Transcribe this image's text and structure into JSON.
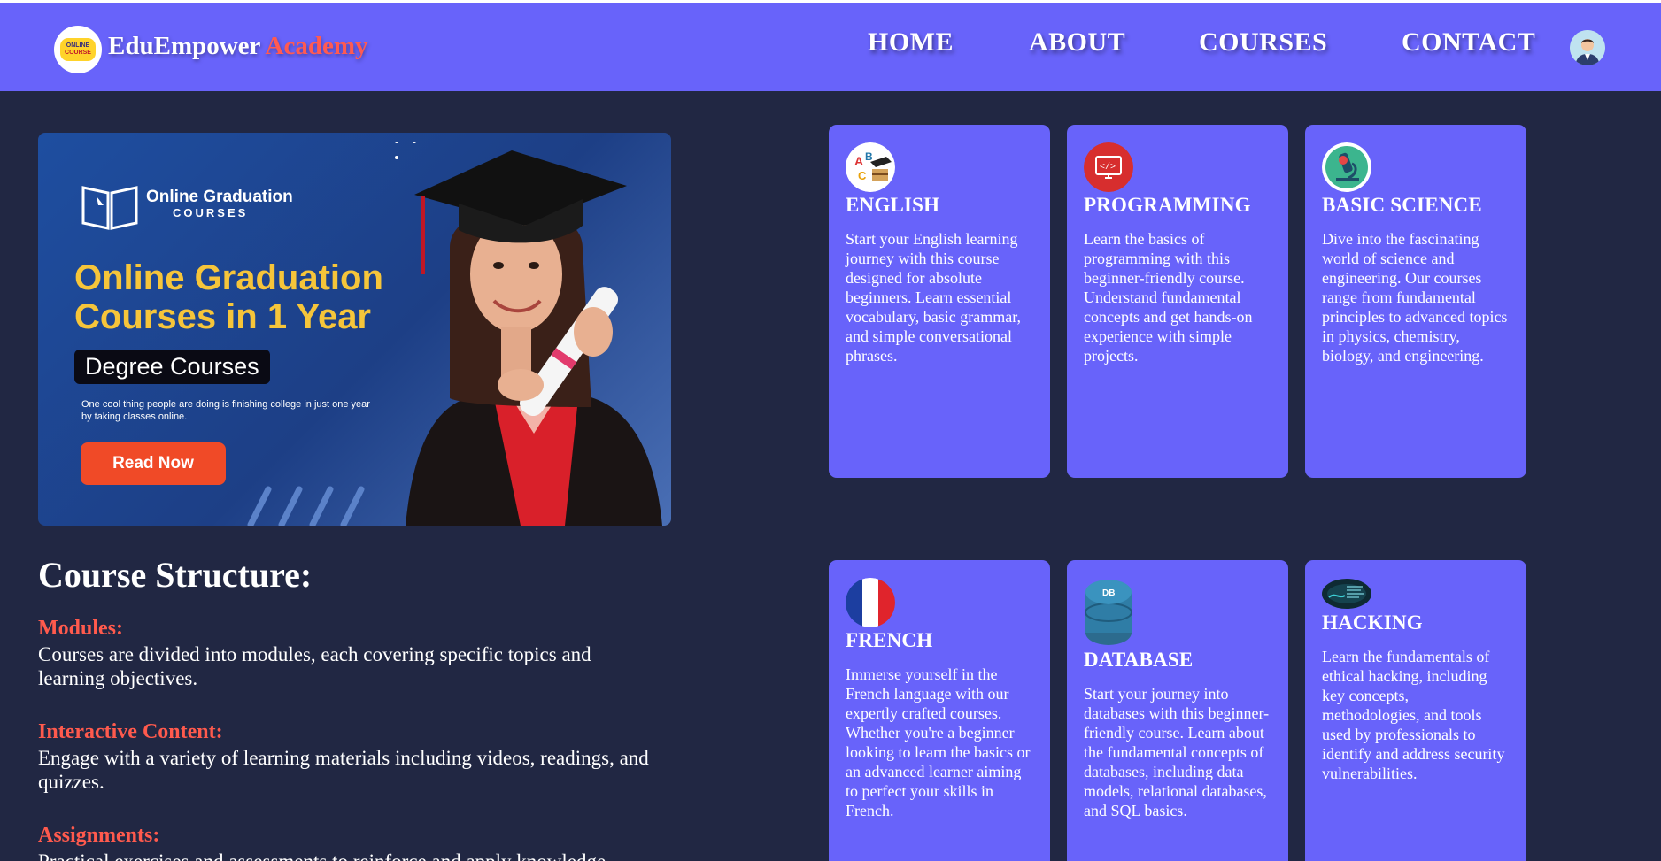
{
  "header": {
    "logo_line1": "ONLINE",
    "logo_line2": "COURSE",
    "brand_name": "EduEmpower",
    "brand_accent": "Academy",
    "nav": [
      "HOME",
      "ABOUT",
      "COURSES",
      "CONTACT"
    ]
  },
  "hero": {
    "brand_title": "Online Graduation",
    "brand_sub": "COURSES",
    "headline": "Online Graduation Courses in 1 Year",
    "pill": "Degree Courses",
    "small_text": "One cool thing people are doing is finishing college in just one year by taking classes online.",
    "button": "Read Now"
  },
  "structure": {
    "title": "Course Structure:",
    "items": [
      {
        "heading": "Modules:",
        "text": "Courses are divided into modules, each covering specific topics and learning objectives."
      },
      {
        "heading": "Interactive Content:",
        "text": "Engage with a variety of learning materials including videos, readings, and quizzes."
      },
      {
        "heading": "Assignments:",
        "text": "Practical exercises and assessments to reinforce and apply knowledge."
      }
    ]
  },
  "courses": [
    {
      "icon": "english-icon",
      "title": "ENGLISH",
      "desc": "Start your English learning journey with this course designed for absolute beginners. Learn essential vocabulary, basic grammar, and simple conversational phrases."
    },
    {
      "icon": "code-icon",
      "title": "PROGRAMMING",
      "desc": "Learn the basics of programming with this beginner-friendly course. Understand fundamental concepts and get hands-on experience with simple projects."
    },
    {
      "icon": "microscope-icon",
      "title": "BASIC SCIENCE",
      "desc": "Dive into the fascinating world of science and engineering. Our courses range from fundamental principles to advanced topics in physics, chemistry, biology, and engineering."
    },
    {
      "icon": "french-flag-icon",
      "title": "FRENCH",
      "desc": "Immerse yourself in the French language with our expertly crafted courses. Whether you're a beginner looking to learn the basics or an advanced learner aiming to perfect your skills in French."
    },
    {
      "icon": "database-icon",
      "title": "DATABASE",
      "desc": "Start your journey into databases with this beginner-friendly course. Learn about the fundamental concepts of databases, including data models, relational databases, and SQL basics."
    },
    {
      "icon": "hacking-icon",
      "title": "HACKING",
      "desc": "Learn the fundamentals of ethical hacking, including key concepts, methodologies, and tools used by professionals to identify and address security vulnerabilities."
    }
  ],
  "colors": {
    "header_bg": "#6863fa",
    "page_bg": "#212743",
    "accent": "#ff5a4d",
    "card_bg": "#6863fa"
  }
}
